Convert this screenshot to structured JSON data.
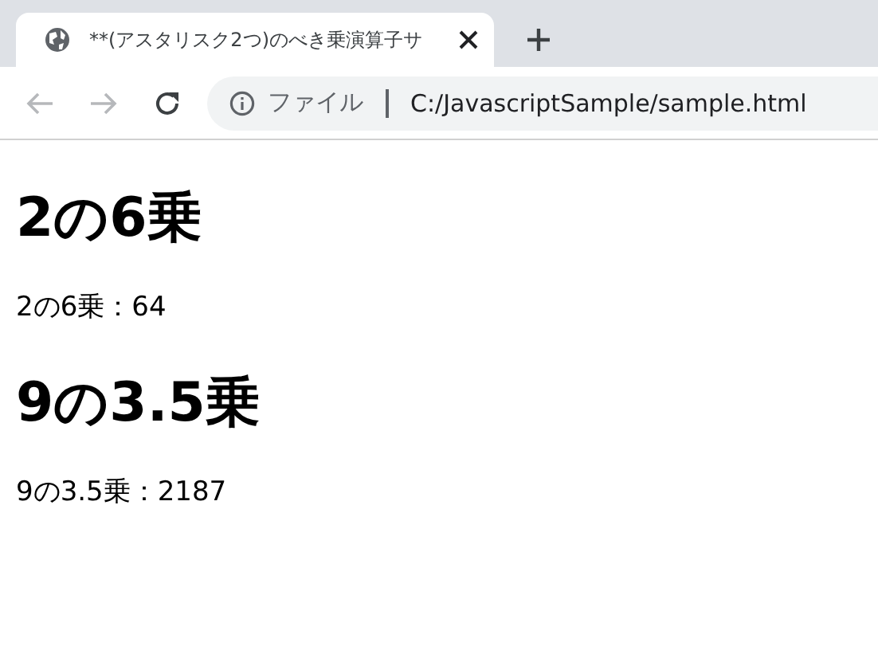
{
  "tabs": [
    {
      "title": "**(アスタリスク2つ)のべき乗演算子サ",
      "selected": true
    }
  ],
  "address_bar": {
    "scheme_label": "ファイル",
    "url": "C:/JavascriptSample/sample.html"
  },
  "content": [
    {
      "kind": "heading",
      "text": "2の6乗"
    },
    {
      "kind": "paragraph",
      "text": "2の6乗：64"
    },
    {
      "kind": "heading",
      "text": "9の3.5乗"
    },
    {
      "kind": "paragraph",
      "text": "9の3.5乗：2187"
    }
  ]
}
